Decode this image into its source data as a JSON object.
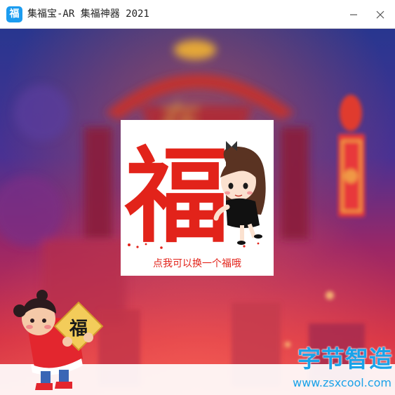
{
  "window": {
    "app_icon_glyph": "福",
    "title": "集福宝-AR 集福神器 2021",
    "minimize_icon": "minimize-icon",
    "close_icon": "close-icon"
  },
  "scene": {
    "background_colors": [
      "#2b2f8f",
      "#6d2a8a",
      "#c2243f",
      "#e4374a"
    ],
    "card": {
      "character": "福",
      "caption": "点我可以换一个福哦",
      "accent_color": "#e2231a"
    },
    "mascot_sign": "福"
  },
  "watermark": {
    "name": "字节智造",
    "url": "www.zsxcool.com",
    "color": "#1aa2e8"
  }
}
